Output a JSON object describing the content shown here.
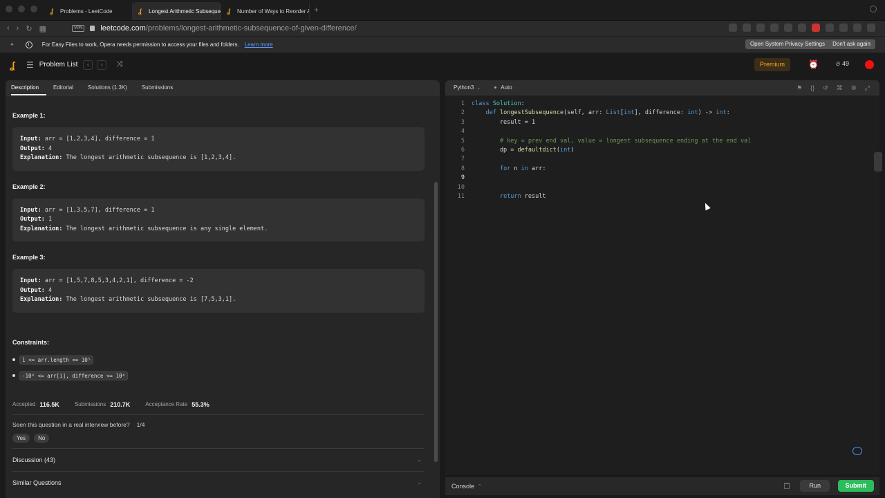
{
  "browser": {
    "tabs": [
      {
        "title": "Problems - LeetCode",
        "active": false
      },
      {
        "title": "Longest Arithmetic Subsequence",
        "active": true
      },
      {
        "title": "Number of Ways to Reorder Arr",
        "active": false
      }
    ],
    "vpn_label": "VPN",
    "url_domain": "leetcode.com",
    "url_path": "/problems/longest-arithmetic-subsequence-of-given-difference/"
  },
  "infobar": {
    "message": "For Easy Files to work, Opera needs permission to access your files and folders.",
    "learn_more": "Learn more",
    "open_settings": "Open System Privacy Settings",
    "dont_ask": "Don't ask again"
  },
  "nav": {
    "problem_list": "Problem List",
    "premium": "Premium",
    "streak": "49"
  },
  "left_tabs": [
    "Description",
    "Editorial",
    "Solutions (1.3K)",
    "Submissions"
  ],
  "examples": [
    {
      "title": "Example 1:",
      "input": "arr = [1,2,3,4], difference = 1",
      "output": "4",
      "explanation": "The longest arithmetic subsequence is [1,2,3,4]."
    },
    {
      "title": "Example 2:",
      "input": "arr = [1,3,5,7], difference = 1",
      "output": "1",
      "explanation": "The longest arithmetic subsequence is any single element."
    },
    {
      "title": "Example 3:",
      "input": "arr = [1,5,7,8,5,3,4,2,1], difference = -2",
      "output": "4",
      "explanation": "The longest arithmetic subsequence is [7,5,3,1]."
    }
  ],
  "labels": {
    "input": "Input:",
    "output": "Output:",
    "explanation": "Explanation:"
  },
  "constraints": {
    "title": "Constraints:",
    "items": [
      "1 <= arr.length <= 10⁵",
      "-10⁴ <= arr[i], difference <= 10⁴"
    ]
  },
  "stats": {
    "accepted_label": "Accepted",
    "accepted": "116.5K",
    "submissions_label": "Submissions",
    "submissions": "210.7K",
    "acceptance_label": "Acceptance Rate",
    "acceptance": "55.3%"
  },
  "interview": {
    "question": "Seen this question in a real interview before?",
    "count": "1/4",
    "yes": "Yes",
    "no": "No"
  },
  "accordions": [
    "Discussion (43)",
    "Similar Questions"
  ],
  "editor": {
    "language": "Python3",
    "mode": "Auto",
    "current_line": 9,
    "lines": [
      "class Solution:",
      "    def longestSubsequence(self, arr: List[int], difference: int) -> int:",
      "        result = 1",
      "",
      "        # key = prev end val, value = longest subsequence ending at the end val",
      "        dp = defaultdict(int)",
      "",
      "        for n in arr:",
      "",
      "",
      "        return result"
    ]
  },
  "console": {
    "label": "Console",
    "run": "Run",
    "submit": "Submit"
  },
  "colors": {
    "accent_orange": "#ffa116",
    "submit_green": "#2cbb5d",
    "link_blue": "#5c9cff"
  }
}
